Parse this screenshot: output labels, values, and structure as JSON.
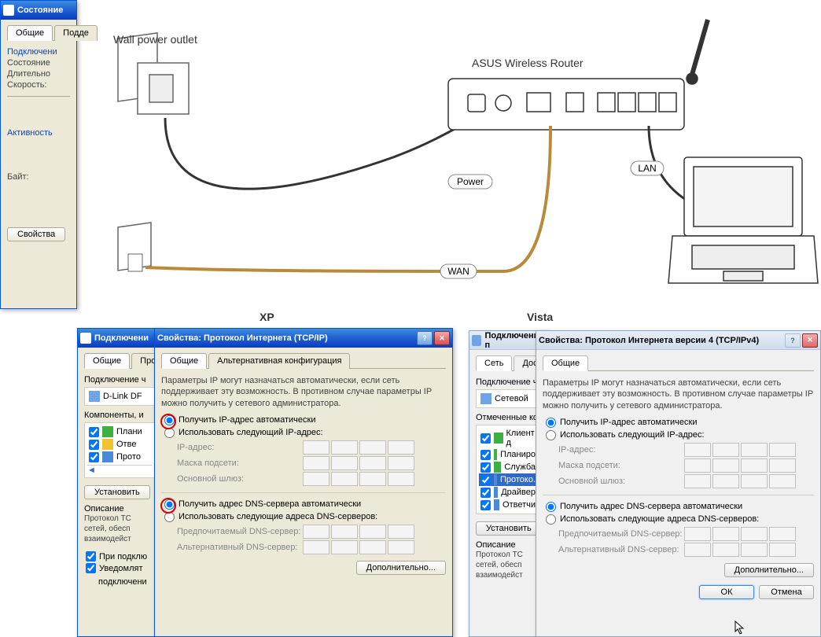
{
  "diagram": {
    "wall_outlet": "Wall power outlet",
    "router": "ASUS Wireless Router",
    "power": "Power",
    "wan": "WAN",
    "lan": "LAN"
  },
  "os": {
    "xp": "XP",
    "vista": "Vista"
  },
  "xp_status": {
    "title": "Состояние",
    "tabs": {
      "general": "Общие",
      "support": "Подде"
    },
    "section_conn": "Подключени",
    "state_lbl": "Состояние",
    "duration_lbl": "Длительно",
    "speed_lbl": "Скорость:",
    "section_activity": "Активность",
    "bytes_lbl": "Байт:",
    "btn_props": "Свойства"
  },
  "xp_conn": {
    "title": "Подключени",
    "tabs": {
      "general": "Общие",
      "check": "Провер"
    },
    "section_adapter": "Подключение ч",
    "adapter": "D-Link DF",
    "components_lbl": "Компоненты, и",
    "comp1": "Плани",
    "comp2": "Отве",
    "comp3": "Прото",
    "btn_install": "Установить",
    "section_desc": "Описание",
    "desc": "Протокол TC сетей, обесп взаимодейст",
    "cb_onconnect": "При подклю",
    "cb_notify": "Уведомлят",
    "bottom": "подключени"
  },
  "xp_tcpip": {
    "title": "Свойства: Протокол Интернета (TCP/IP)",
    "tabs": {
      "general": "Общие",
      "alt": "Альтернативная конфигурация"
    },
    "info": "Параметры IP могут назначаться автоматически, если сеть поддерживает эту возможность. В противном случае параметры IP можно получить у сетевого администратора.",
    "r_auto_ip": "Получить IP-адрес автоматически",
    "r_manual_ip": "Использовать следующий IP-адрес:",
    "ip_addr": "IP-адрес:",
    "mask": "Маска подсети:",
    "gateway": "Основной шлюз:",
    "r_auto_dns": "Получить адрес DNS-сервера автоматически",
    "r_manual_dns": "Использовать следующие адреса DNS-серверов:",
    "dns1": "Предпочитаемый DNS-сервер:",
    "dns2": "Альтернативный DNS-сервер:",
    "btn_adv": "Дополнительно..."
  },
  "vista_conn": {
    "title": "Подключение п",
    "tabs": {
      "net": "Сеть",
      "access": "Доступ"
    },
    "section_adapter": "Подключение ч",
    "adapter": "Сетевой",
    "components_lbl": "Отмеченные ко",
    "comp1": "Клиент д",
    "comp2": "Планиро",
    "comp3": "Служба",
    "comp4": "Протоко.",
    "comp5": "Драйвер",
    "comp6": "Ответчи",
    "btn_install": "Установить",
    "section_desc": "Описание",
    "desc": "Протокол TC сетей, обесп взаимодейст"
  },
  "vista_tcpip": {
    "title": "Свойства: Протокол Интернета версии 4 (TCP/IPv4)",
    "tabs": {
      "general": "Общие"
    },
    "info": "Параметры IP могут назначаться автоматически, если сеть поддерживает эту возможность. В противном случае параметры IP можно получить у сетевого администратора.",
    "r_auto_ip": "Получить IP-адрес автоматически",
    "r_manual_ip": "Использовать следующий IP-адрес:",
    "ip_addr": "IP-адрес:",
    "mask": "Маска подсети:",
    "gateway": "Основной шлюз:",
    "r_auto_dns": "Получить адрес DNS-сервера автоматически",
    "r_manual_dns": "Использовать следующие адреса DNS-серверов:",
    "dns1": "Предпочитаемый DNS-сервер:",
    "dns2": "Альтернативный DNS-сервер:",
    "btn_adv": "Дополнительно...",
    "btn_ok": "ОК",
    "btn_cancel": "Отмена"
  }
}
